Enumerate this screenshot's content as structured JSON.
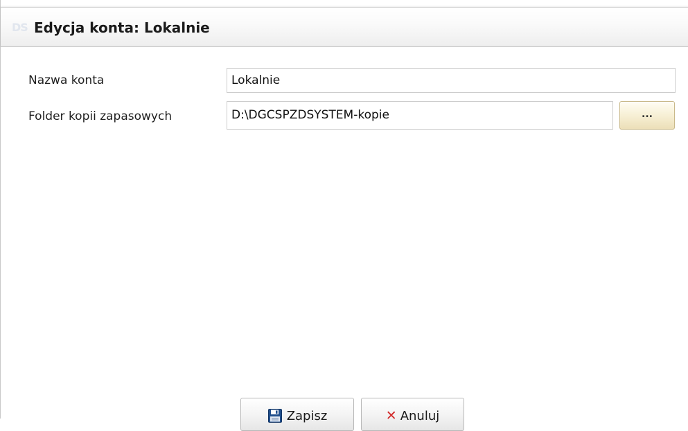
{
  "window": {
    "logo": "DS",
    "title": "Edycja konta: Lokalnie"
  },
  "form": {
    "account_name": {
      "label": "Nazwa konta",
      "value": "Lokalnie"
    },
    "backup_folder": {
      "label": "Folder kopii zapasowych",
      "value": "D:\\DGCSPZDSYSTEM-kopie",
      "browse_label": "..."
    }
  },
  "footer": {
    "save_label": "Zapisz",
    "cancel_label": "Anuluj"
  },
  "icons": {
    "save": "floppy-disk-icon",
    "cancel": "close-icon"
  },
  "colors": {
    "browse_button": "#f6eed2",
    "cancel_icon": "#d22c2c",
    "save_icon": "#1f4e8c"
  }
}
